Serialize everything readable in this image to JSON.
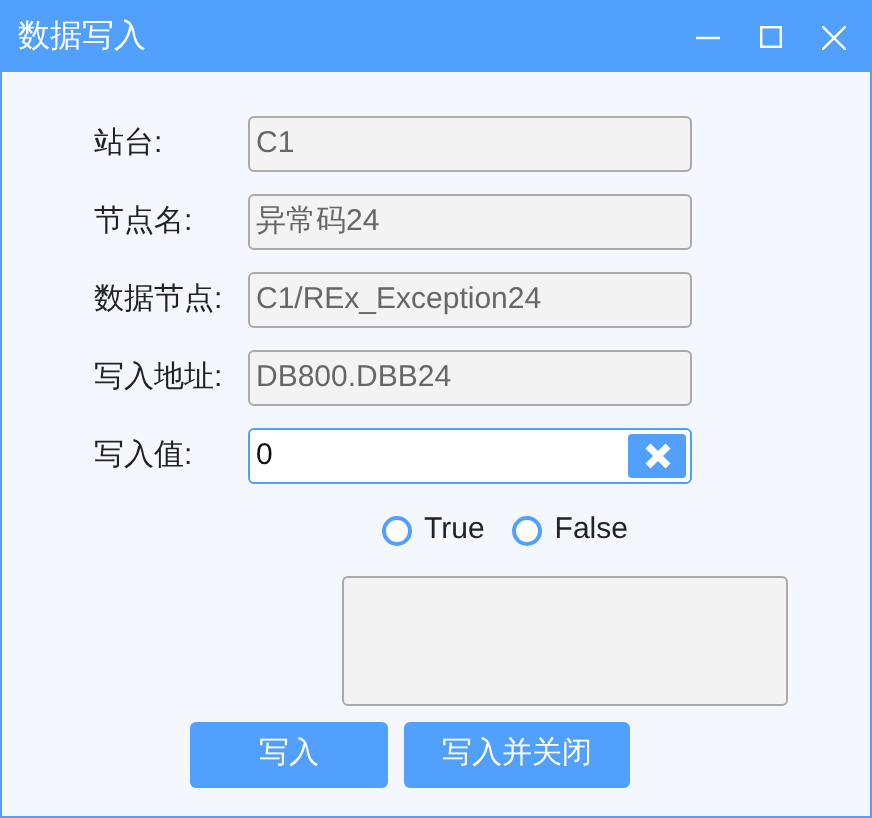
{
  "window": {
    "title": "数据写入"
  },
  "fields": [
    {
      "label": "站台:",
      "value": "C1",
      "kind": "readonly"
    },
    {
      "label": "节点名:",
      "value": "异常码24",
      "kind": "readonly"
    },
    {
      "label": "数据节点:",
      "value": "C1/REx_Exception24",
      "kind": "readonly"
    },
    {
      "label": "写入地址:",
      "value": "DB800.DBB24",
      "kind": "readonly"
    },
    {
      "label": "写入值:",
      "value": "0",
      "kind": "editable"
    }
  ],
  "options": [
    {
      "label": "True",
      "selected": false
    },
    {
      "label": "False",
      "selected": false
    }
  ],
  "buttons": [
    "写入",
    "写入并关闭"
  ]
}
